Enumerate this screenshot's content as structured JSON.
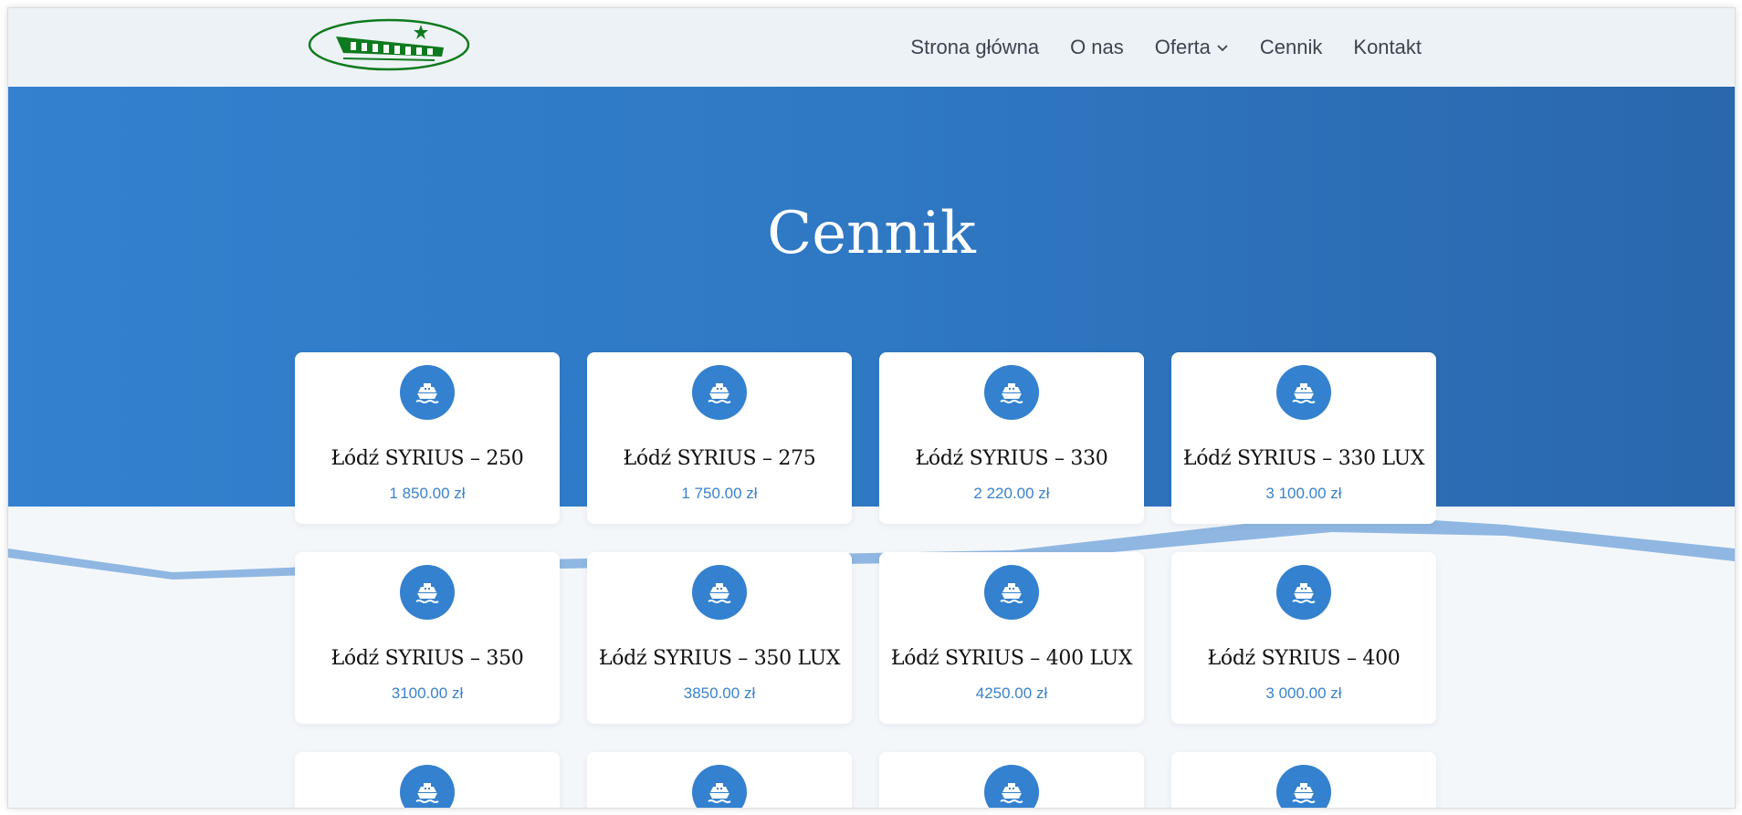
{
  "header": {
    "logo_alt": "SYRIUSZ",
    "nav": [
      {
        "label": "Strona główna"
      },
      {
        "label": "O nas"
      },
      {
        "label": "Oferta",
        "has_dropdown": true
      },
      {
        "label": "Cennik"
      },
      {
        "label": "Kontakt"
      }
    ]
  },
  "hero": {
    "title": "Cennik"
  },
  "icons": {
    "card_icon": "ship-icon",
    "dropdown_icon": "chevron-down-icon"
  },
  "colors": {
    "accent": "#3381cf",
    "price": "#3a82cc",
    "logo_green": "#0e7a1e"
  },
  "products": [
    {
      "name": "Łódź SYRIUS – 250",
      "price": "1 850.00 zł"
    },
    {
      "name": "Łódź SYRIUS – 275",
      "price": "1 750.00 zł"
    },
    {
      "name": "Łódź SYRIUS – 330",
      "price": "2 220.00 zł"
    },
    {
      "name": "Łódź SYRIUS – 330 LUX",
      "price": "3 100.00 zł"
    },
    {
      "name": "Łódź SYRIUS – 350",
      "price": "3100.00 zł"
    },
    {
      "name": "Łódź SYRIUS – 350 LUX",
      "price": "3850.00 zł"
    },
    {
      "name": "Łódź SYRIUS – 400 LUX",
      "price": "4250.00 zł"
    },
    {
      "name": "Łódź SYRIUS – 400",
      "price": "3 000.00 zł"
    }
  ]
}
